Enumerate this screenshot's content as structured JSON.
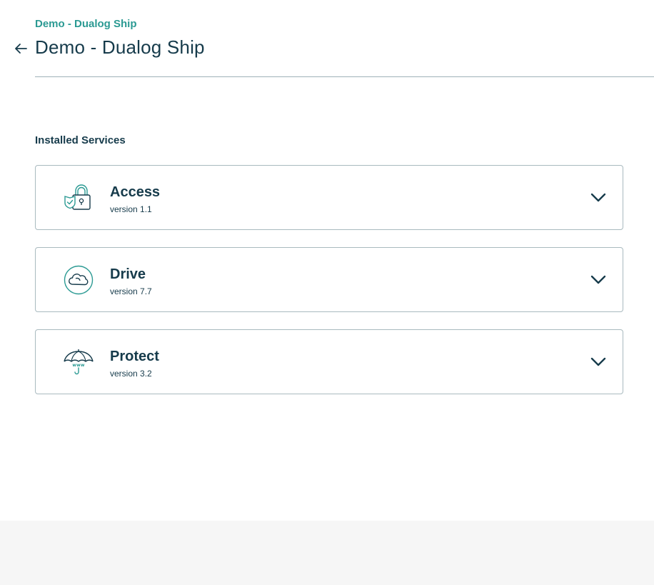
{
  "header": {
    "breadcrumb": "Demo - Dualog Ship",
    "title": "Demo - Dualog Ship"
  },
  "installed": {
    "heading": "Installed Services",
    "services": [
      {
        "name": "Access",
        "version": "version 1.1",
        "icon": "lock-shield-icon"
      },
      {
        "name": "Drive",
        "version": "version 7.7",
        "icon": "cloud-icon"
      },
      {
        "name": "Protect",
        "version": "version 3.2",
        "icon": "umbrella-www-icon"
      }
    ]
  },
  "colors": {
    "accent": "#2b9a93",
    "text": "#163b4b",
    "border": "#a9babf",
    "footer_bg": "#f6f6f6"
  }
}
